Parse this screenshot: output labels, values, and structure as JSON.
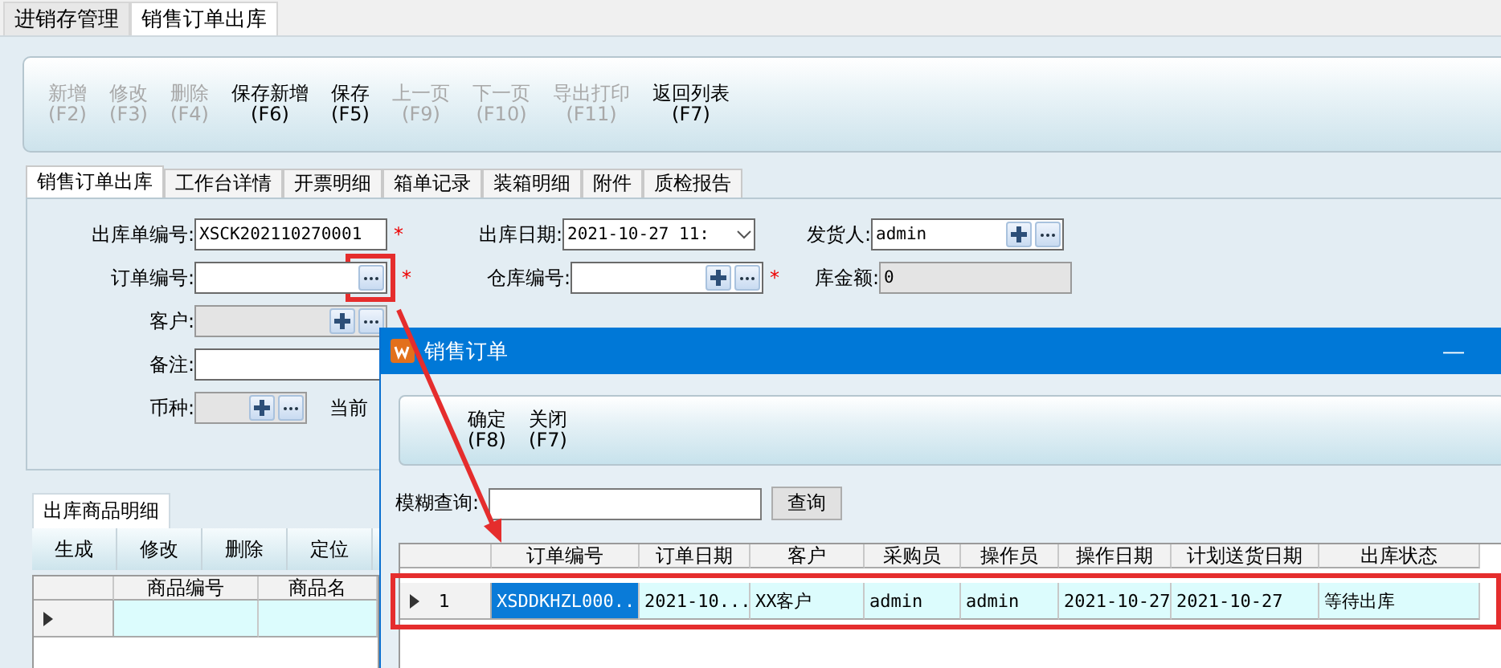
{
  "app_tabs": [
    {
      "label": "进销存管理",
      "selected": false
    },
    {
      "label": "销售订单出库",
      "selected": true
    }
  ],
  "toolbar": [
    {
      "label": "新增",
      "key": "(F2)",
      "disabled": true
    },
    {
      "label": "修改",
      "key": "(F3)",
      "disabled": true
    },
    {
      "label": "删除",
      "key": "(F4)",
      "disabled": true
    },
    {
      "label": "保存新增",
      "key": "(F6)",
      "disabled": false
    },
    {
      "label": "保存",
      "key": "(F5)",
      "disabled": false
    },
    {
      "label": "上一页",
      "key": "(F9)",
      "disabled": true
    },
    {
      "label": "下一页",
      "key": "(F10)",
      "disabled": true
    },
    {
      "label": "导出打印",
      "key": "(F11)",
      "disabled": true
    },
    {
      "label": "返回列表",
      "key": "(F7)",
      "disabled": false
    }
  ],
  "form_tabs": [
    {
      "label": "销售订单出库",
      "selected": true
    },
    {
      "label": "工作台详情",
      "selected": false
    },
    {
      "label": "开票明细",
      "selected": false
    },
    {
      "label": "箱单记录",
      "selected": false
    },
    {
      "label": "装箱明细",
      "selected": false
    },
    {
      "label": "附件",
      "selected": false
    },
    {
      "label": "质检报告",
      "selected": false
    }
  ],
  "form_rows": [
    {
      "fields": [
        {
          "label": "出库单编号:",
          "value": "XSCK202110270001",
          "kind": "text",
          "required_mark": "*",
          "readonly": false
        },
        {
          "label": "出库日期:",
          "value": "2021-10-27 11:",
          "kind": "date",
          "readonly": false
        },
        {
          "label": "发货人:",
          "value": "admin",
          "kind": "lookup_add",
          "readonly": false
        }
      ]
    },
    {
      "fields": [
        {
          "label": "订单编号:",
          "kind": "lookup",
          "required_mark": "*",
          "readonly": false,
          "highlight": true
        },
        {
          "label": "仓库编号:",
          "kind": "lookup_add",
          "required_mark": "*",
          "readonly": false
        },
        {
          "label": "库金额:",
          "value": "0",
          "kind": "text",
          "readonly": true
        }
      ]
    },
    {
      "fields": [
        {
          "label": "客户:",
          "kind": "lookup_add",
          "readonly": true
        }
      ]
    },
    {
      "fields": [
        {
          "label": "备注:",
          "kind": "wide",
          "readonly": false
        }
      ]
    },
    {
      "fields": [
        {
          "label": "币种:",
          "kind": "lookup_add_short",
          "readonly": true
        },
        {
          "label": "当前",
          "kind": "label_only"
        }
      ]
    }
  ],
  "detail": {
    "tab": "出库商品明细",
    "buttons": [
      "生成",
      "修改",
      "删除",
      "定位"
    ],
    "columns": [
      "商品编号",
      "商品名"
    ],
    "rows": [
      {
        "current": true,
        "cells": [
          "",
          ""
        ]
      }
    ]
  },
  "dialog": {
    "title": "销售订单",
    "minimize": "—",
    "toolbar": [
      {
        "label": "确定",
        "key": "(F8)"
      },
      {
        "label": "关闭",
        "key": "(F7)"
      }
    ],
    "search": {
      "label": "模糊查询:",
      "button": "查询"
    },
    "columns": [
      "订单编号",
      "订单日期",
      "客户",
      "采购员",
      "操作员",
      "操作日期",
      "计划送货日期",
      "出库状态"
    ],
    "rows": [
      {
        "number": "1",
        "current": true,
        "selected": true,
        "highlight": true,
        "cells": [
          "XSDDKHZL000...",
          "2021-10...",
          "XX客户",
          "admin",
          "admin",
          "2021-10-27",
          "2021-10-27",
          "等待出库"
        ]
      }
    ]
  }
}
